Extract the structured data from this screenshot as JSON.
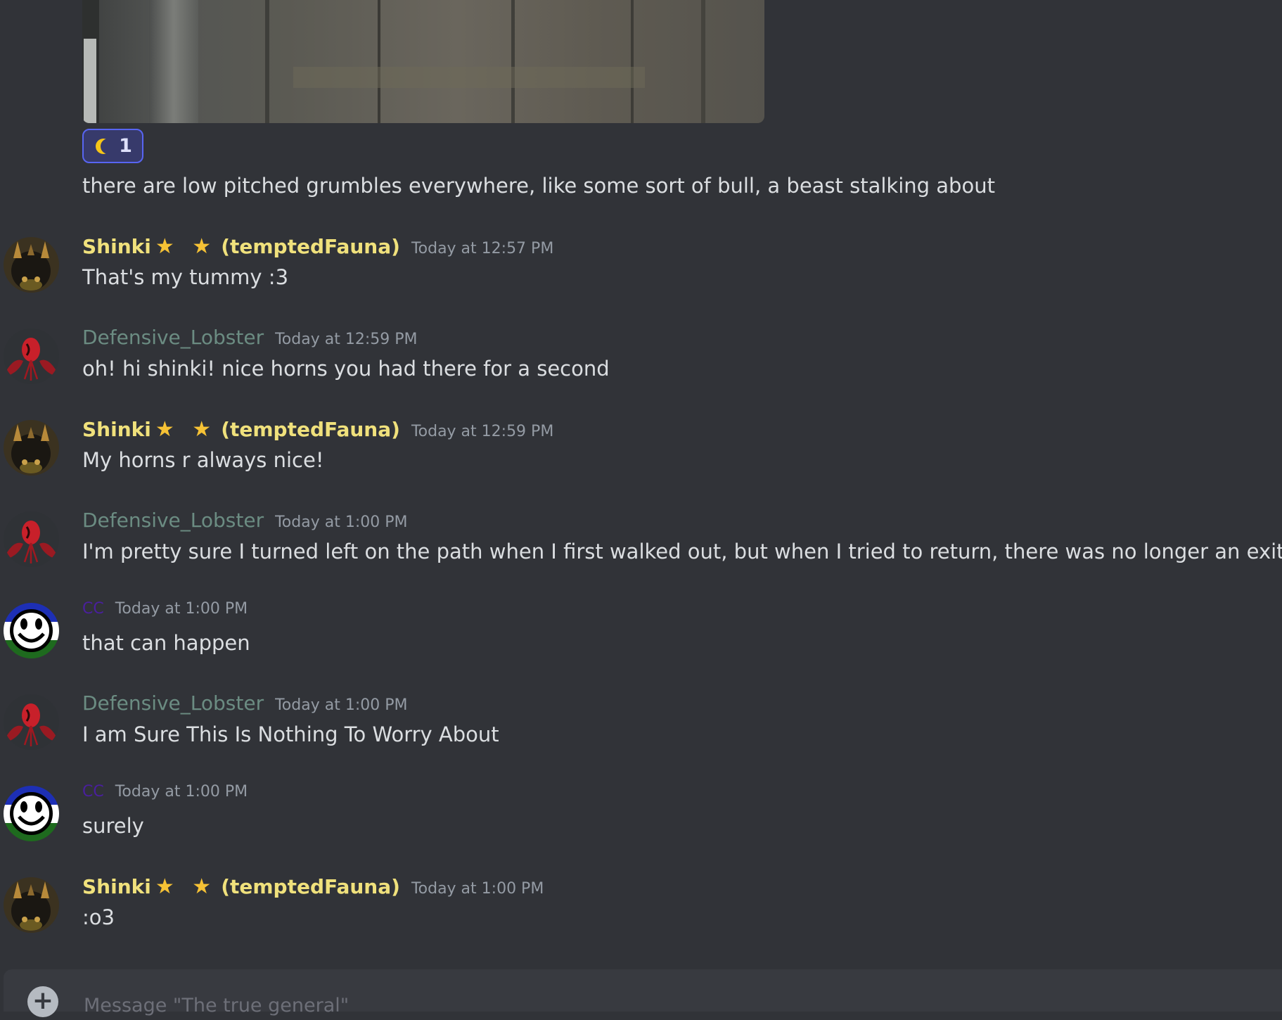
{
  "channel": {
    "name": "The true general"
  },
  "composer": {
    "placeholder": "Message \"The true general\""
  },
  "reaction": {
    "emoji": "crescent-moon",
    "count": "1",
    "colors": {
      "border": "#5865f2",
      "bg": "#373a6b"
    }
  },
  "prior_message_text": "there are low pitched grumbles everywhere, like some sort of bull, a beast stalking about",
  "messages": [
    {
      "author": "Shinki",
      "stars": "★ ★",
      "handle": "(temptedFauna)",
      "time": "Today at 12:57 PM",
      "text": "That's my tummy :3",
      "avatar": "shinki"
    },
    {
      "author": "Defensive_Lobster",
      "time": "Today at 12:59 PM",
      "text": "oh! hi shinki! nice horns you had there for a second",
      "avatar": "lobster"
    },
    {
      "author": "Shinki",
      "stars": "★ ★",
      "handle": "(temptedFauna)",
      "time": "Today at 12:59 PM",
      "text": "My horns r always nice!",
      "avatar": "shinki"
    },
    {
      "author": "Defensive_Lobster",
      "time": "Today at 1:00 PM",
      "text": "I'm pretty sure I turned left on the path when I first walked out, but when I tried to return, there was no longer an exit there",
      "avatar": "lobster"
    },
    {
      "author": "CC",
      "time": "Today at 1:00 PM",
      "text": "that can happen",
      "avatar": "cc"
    },
    {
      "author": "Defensive_Lobster",
      "time": "Today at 1:00 PM",
      "text": "I am Sure This Is Nothing To Worry About",
      "avatar": "lobster"
    },
    {
      "author": "CC",
      "time": "Today at 1:00 PM",
      "text": "surely",
      "avatar": "cc"
    },
    {
      "author": "Shinki",
      "stars": "★ ★",
      "handle": "(temptedFauna)",
      "time": "Today at 1:00 PM",
      "text": ":o3",
      "avatar": "shinki"
    }
  ],
  "colors": {
    "background": "#313338",
    "shinki_name": "#f0e17c",
    "lobster_name": "#6b8c82",
    "cc_name": "#4a1f9e",
    "timestamp": "#949ba4",
    "text": "#dbdee1"
  }
}
